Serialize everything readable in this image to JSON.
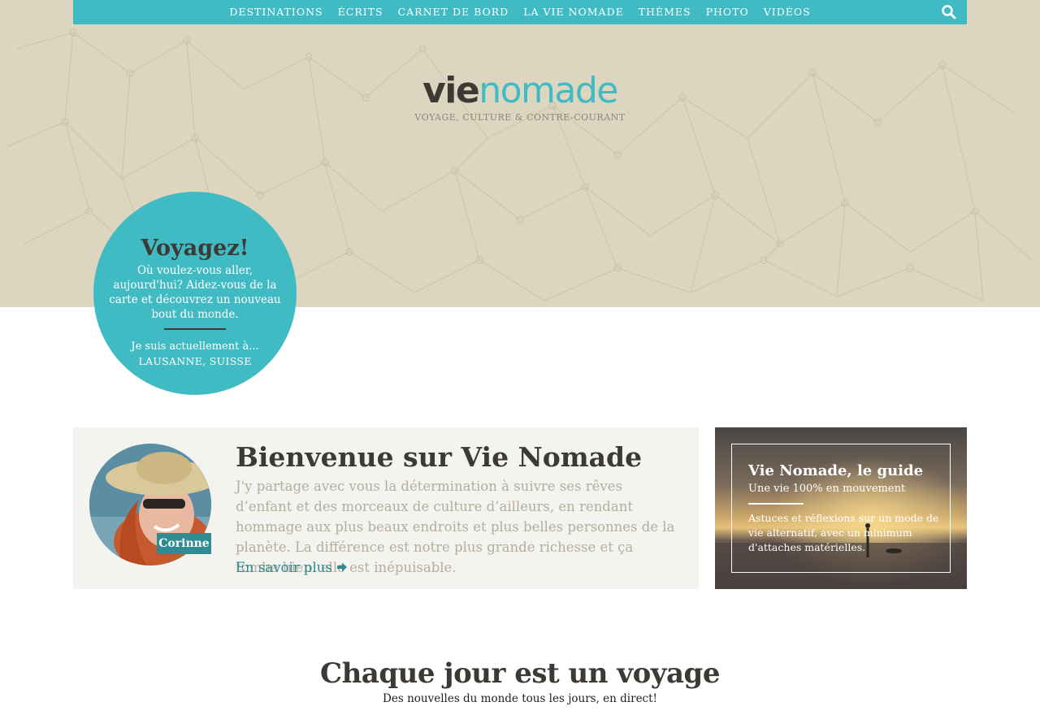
{
  "nav": {
    "items": [
      "DESTINATIONS",
      "ÉCRITS",
      "CARNET DE BORD",
      "LA VIE NOMADE",
      "THÈMES",
      "PHOTO",
      "VIDÉOS"
    ],
    "search_icon": "search-icon"
  },
  "logo": {
    "vie": "vie",
    "nomade": "nomade",
    "tagline": "VOYAGE, CULTURE & CONTRE-COURANT"
  },
  "circle": {
    "title": "Voyagez!",
    "text": "Où voulez-vous aller, aujourd'hui? Aidez-vous de la carte et découvrez un nouveau bout du monde.",
    "current_label": "Je suis actuellement à...",
    "location": "LAUSANNE, SUISSE"
  },
  "welcome": {
    "avatar_name": "Corinne",
    "title": "Bienvenue sur Vie Nomade",
    "text": "J'y partage avec vous la détermination à suivre ses rêves d’enfant et des morceaux de culture d’ailleurs, en rendant hommage aux plus beaux endroits et plus belles personnes de la planète. La différence est notre plus grande richesse et ça tombe bien: elle est inépuisable.",
    "link": "En savoir plus"
  },
  "guide": {
    "title": "Vie Nomade, le guide",
    "subtitle": "Une vie 100% en mouvement",
    "text": "Astuces et réflexions sur un mode de vie alternatif, avec un minimum d'attaches matérielles."
  },
  "section": {
    "title": "Chaque jour est un voyage",
    "subtitle": "Des nouvelles du monde tous les jours, en direct!"
  },
  "colors": {
    "accent": "#40bbc3",
    "accent_dark": "#2f8c92",
    "hero_bg": "#dcd5bf",
    "text_dark": "#3d3a35",
    "text_muted": "#b4ae9b"
  }
}
